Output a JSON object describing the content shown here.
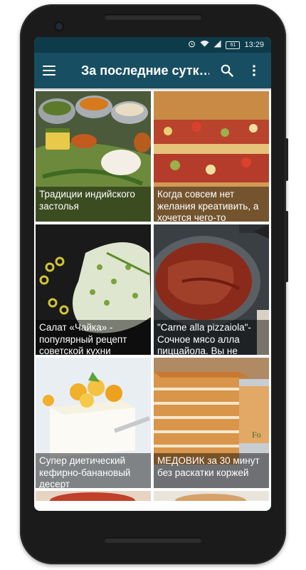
{
  "status_bar": {
    "time": "13:29",
    "battery": "61",
    "icons": [
      "alarm-icon",
      "wifi-icon",
      "signal-icon",
      "battery-icon"
    ]
  },
  "app_bar": {
    "title": "За последние сутк…",
    "menu_icon": "hamburger-menu-icon",
    "search_icon": "search-icon",
    "more_icon": "more-vert-icon"
  },
  "recipes": [
    {
      "caption": "Традиции индийского застолья"
    },
    {
      "caption": "Когда совсем нет желания креативить, а хочется чего-то"
    },
    {
      "caption": "Салат «Чайка» - популярный рецепт советской кухни"
    },
    {
      "caption": "\"Carne alla pizzaiola\"- Сочное мясо алла пиццайола. Вы не"
    },
    {
      "caption": "Супер диетический кефирно-банановый десерт"
    },
    {
      "caption": "МЕДОВИК за 30 минут без раскатки коржей"
    }
  ],
  "colors": {
    "app_bar": "#184e62",
    "status_bar": "#0e3b4a",
    "caption_overlay": "rgba(0,0,0,0.45)"
  }
}
